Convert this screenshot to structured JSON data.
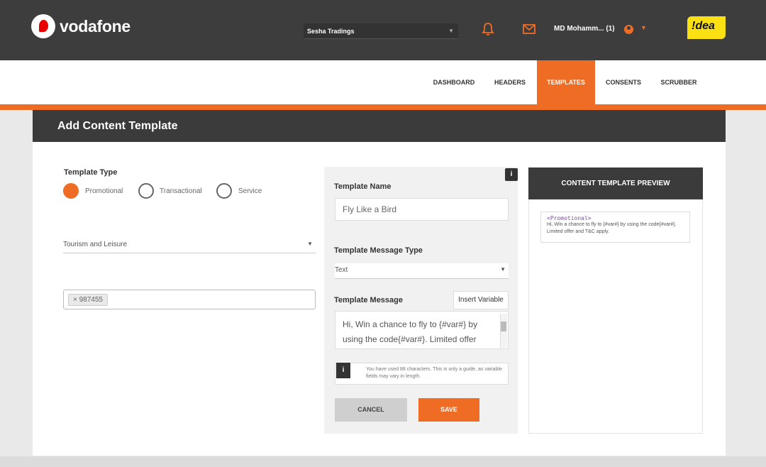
{
  "header": {
    "brand": "vodafone",
    "company_select": "Sesha Tradings",
    "user_name": "MD Mohamm... (1)",
    "partner_logo": "!dea",
    "icons": [
      "bell-icon",
      "mail-icon",
      "user-icon",
      "chevron-down-icon"
    ]
  },
  "nav": {
    "items": [
      {
        "label": "DASHBOARD",
        "active": false
      },
      {
        "label": "HEADERS",
        "active": false
      },
      {
        "label": "TEMPLATES",
        "active": true
      },
      {
        "label": "CONSENTS",
        "active": false
      },
      {
        "label": "SCRUBBER",
        "active": false
      }
    ]
  },
  "panel": {
    "title": "Add Content Template"
  },
  "form": {
    "template_type_label": "Template Type",
    "template_types": [
      {
        "label": "Promotional",
        "selected": true
      },
      {
        "label": "Transactional",
        "selected": false
      },
      {
        "label": "Service",
        "selected": false
      }
    ],
    "category_value": "Tourism and Leisure",
    "header_tag": "× 987455",
    "template_name_label": "Template Name",
    "template_name_value": "Fly Like a Bird",
    "message_type_label": "Template Message Type",
    "message_type_value": "Text",
    "message_label": "Template Message",
    "insert_variable_label": "Insert Variable",
    "message_value": "Hi, Win a chance to fly to {#var#} by using the code{#var#}. Limited offer",
    "hint_text": "You have used 88 characters. This is only a guide, as variable fields may vary in length.",
    "cancel_label": "CANCEL",
    "save_label": "SAVE"
  },
  "preview": {
    "title": "CONTENT TEMPLATE PREVIEW",
    "type_tag": "<Promotional>",
    "text": "Hi, Win a chance to fly to {#var#} by using the code{#var#}. Limited offer and T&C apply."
  },
  "colors": {
    "accent": "#ef6c24",
    "dark": "#3d3d3d",
    "brand_red": "#e60000",
    "idea_yellow": "#fbe114"
  }
}
